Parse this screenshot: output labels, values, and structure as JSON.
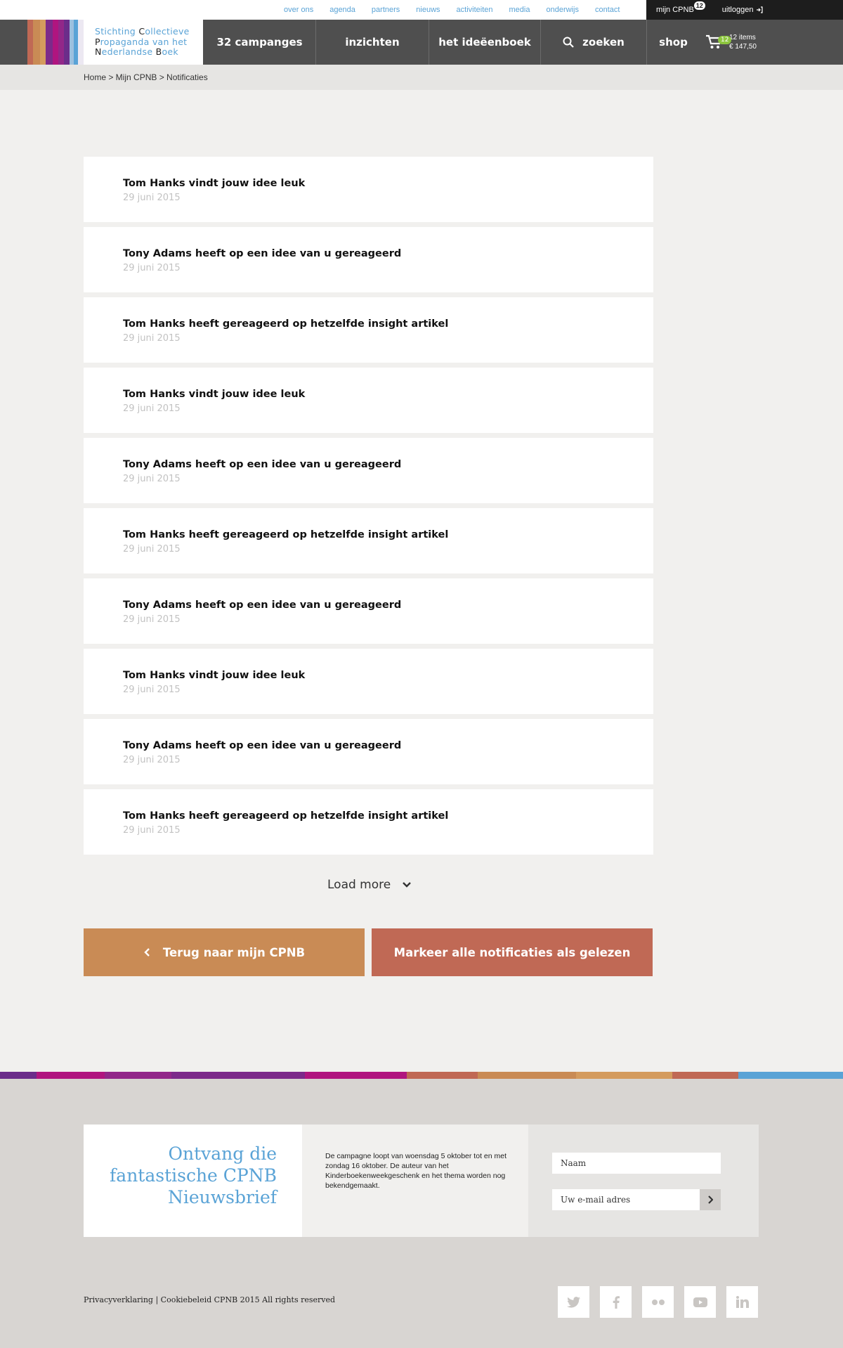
{
  "util_nav": [
    "over ons",
    "agenda",
    "partners",
    "nieuws",
    "activiteiten",
    "media",
    "onderwijs",
    "contact"
  ],
  "account": {
    "mijn_label": "mijn CPNB",
    "mijn_badge": "12",
    "logout_label": "uitloggen"
  },
  "logo": {
    "line1a": "Stichting ",
    "line1b": "C",
    "line1c": "ollectieve",
    "line2a": "P",
    "line2b": "ropaganda van het",
    "line3a": "N",
    "line3b": "ederlandse ",
    "line3c": "B",
    "line3d": "oek"
  },
  "nav": {
    "campaigns": "32 campanges",
    "insights": "inzichten",
    "ideas": "het ideëenboek",
    "search": "zoeken",
    "shop": "shop"
  },
  "cart": {
    "badge": "12",
    "items": "12 items",
    "total": "€ 147,50"
  },
  "breadcrumb": "Home > Mijn CPNB > Notificaties",
  "notifications": [
    {
      "title": "Tom Hanks vindt jouw idee leuk",
      "date": "29 juni 2015"
    },
    {
      "title": "Tony Adams heeft op een idee van u gereageerd",
      "date": "29 juni 2015"
    },
    {
      "title": "Tom Hanks heeft gereageerd op hetzelfde insight artikel",
      "date": "29 juni 2015"
    },
    {
      "title": "Tom Hanks vindt jouw idee leuk",
      "date": "29 juni 2015"
    },
    {
      "title": "Tony Adams heeft op een idee van u gereageerd",
      "date": "29 juni 2015"
    },
    {
      "title": "Tom Hanks heeft gereageerd op hetzelfde insight artikel",
      "date": "29 juni 2015"
    },
    {
      "title": "Tony Adams heeft op een idee van u gereageerd",
      "date": "29 juni 2015"
    },
    {
      "title": "Tom Hanks vindt jouw idee leuk",
      "date": "29 juni 2015"
    },
    {
      "title": "Tony Adams heeft op een idee van u gereageerd",
      "date": "29 juni 2015"
    },
    {
      "title": "Tom Hanks heeft gereageerd op hetzelfde insight artikel",
      "date": "29 juni 2015"
    }
  ],
  "load_more": "Load more",
  "buttons": {
    "back": "Terug naar mijn CPNB",
    "mark_all": "Markeer alle notificaties als gelezen"
  },
  "newsletter": {
    "title": "Ontvang die fantastische CPNB Nieuwsbrief",
    "text": "De campagne loopt van woensdag 5 oktober tot en met zondag 16 oktober. De auteur van het Kinderboekenweekgeschenk en het thema worden nog bekendgemaakt.",
    "name_placeholder": "Naam",
    "email_placeholder": "Uw e-mail adres"
  },
  "footer_text": "Privacyverklaring | Cookiebeleid  CPNB 2015 All rights reserved",
  "socials": [
    "twitter-icon",
    "facebook-icon",
    "flickr-icon",
    "youtube-icon",
    "linkedin-icon"
  ],
  "colors": {
    "accent_blue": "#5aa3d6",
    "nav_bg": "#4f4f4f",
    "btn_orange": "#c98b55",
    "btn_red": "#c06955",
    "cart_badge": "#8dc63f"
  }
}
